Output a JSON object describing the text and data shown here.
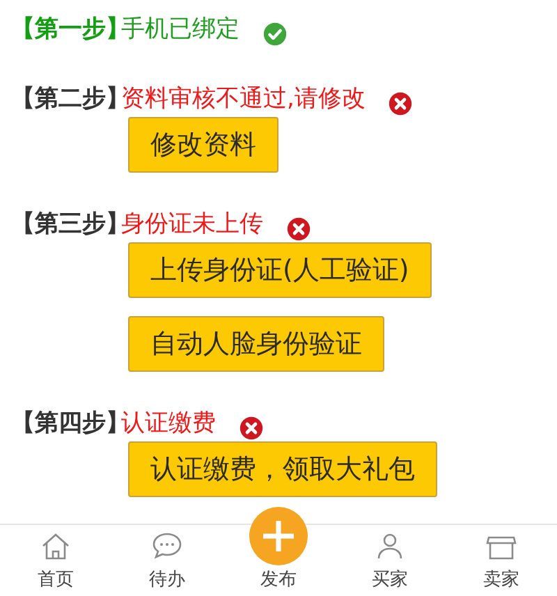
{
  "steps": [
    {
      "label": "【第一步】",
      "status": "手机已绑定",
      "completed": true
    },
    {
      "label": "【第二步】",
      "status": "资料审核不通过,请修改",
      "completed": false,
      "buttons": [
        "修改资料"
      ]
    },
    {
      "label": "【第三步】",
      "status": "身份证未上传",
      "completed": false,
      "buttons": [
        "上传身份证(人工验证)",
        "自动人脸身份验证"
      ]
    },
    {
      "label": "【第四步】",
      "status": "认证缴费",
      "completed": false,
      "buttons": [
        "认证缴费，领取大礼包"
      ]
    }
  ],
  "tab_bar": [
    {
      "label": "首页",
      "kind": "home"
    },
    {
      "label": "待办",
      "kind": "chat"
    },
    {
      "label": "发布",
      "kind": "publish"
    },
    {
      "label": "买家",
      "kind": "buyer"
    },
    {
      "label": "卖家",
      "kind": "seller"
    }
  ]
}
